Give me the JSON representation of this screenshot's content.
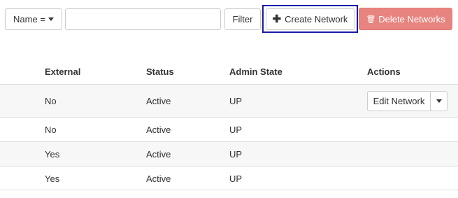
{
  "toolbar": {
    "filter_field_label": "Name =",
    "filter_value": "",
    "filter_button": "Filter",
    "create_button": "Create Network",
    "delete_button": "Delete Networks"
  },
  "table": {
    "columns": [
      "External",
      "Status",
      "Admin State",
      "Actions"
    ],
    "rows": [
      {
        "external": "No",
        "status": "Active",
        "admin_state": "UP",
        "action": "Edit Network"
      },
      {
        "external": "No",
        "status": "Active",
        "admin_state": "UP"
      },
      {
        "external": "Yes",
        "status": "Active",
        "admin_state": "UP"
      },
      {
        "external": "Yes",
        "status": "Active",
        "admin_state": "UP"
      }
    ]
  },
  "colors": {
    "focus_outline": "#1a1aa8",
    "danger": "#e8847f",
    "row_stripe": "#f7f7f7"
  },
  "icons": [
    "caret-down-icon",
    "plus-icon",
    "trash-icon"
  ]
}
